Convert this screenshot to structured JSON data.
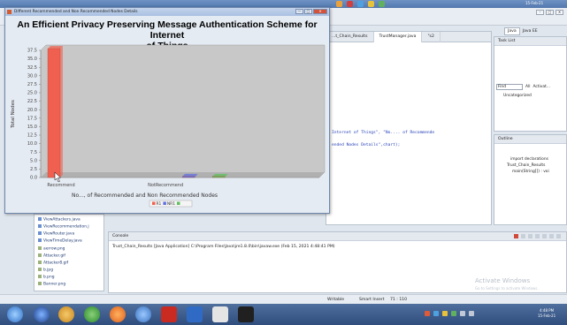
{
  "system_bar": {
    "date": "15-Feb-21"
  },
  "chart_window": {
    "title": "Different Recommended and Non Recommended Nodes Details",
    "controls": {
      "minimize": "—",
      "maximize": "□",
      "close": "✕"
    }
  },
  "chart_data": {
    "type": "bar",
    "title": "An Efficient Privacy Preserving Message Authentication Scheme for Internet of Things",
    "title_line1": "An Efficient Privacy Preserving Message Authentication Scheme for Internet",
    "title_line2": "of Things",
    "xlabel": "No..., of Recommended and Non Recommended Nodes",
    "ylabel": "Total Nodes",
    "categories": [
      "Recommend",
      "NotRecommend"
    ],
    "series": [
      {
        "name": "R1",
        "color": "#f06050",
        "values": [
          38,
          0
        ]
      },
      {
        "name": "NR1",
        "color": "#6070e0",
        "values": [
          0,
          0.3
        ]
      },
      {
        "name": "",
        "color": "#5ec05e",
        "values": [
          0,
          0.3
        ]
      }
    ],
    "ylim": [
      0,
      37.5
    ],
    "yticks": [
      "0.0",
      "2.5",
      "5.0",
      "7.5",
      "10.0",
      "12.5",
      "15.0",
      "17.5",
      "20.0",
      "22.5",
      "25.0",
      "27.5",
      "30.0",
      "32.5",
      "35.0",
      "37.5"
    ],
    "legend": "bottom-center",
    "grid": false
  },
  "editor": {
    "tabs": [
      "...t_Chain_Results",
      "TrustManager.java",
      "\"s2"
    ],
    "code_lines": [
      "Internet of Things\", \"No.... of Recommende",
      "ended Nodes Details\",chart);"
    ]
  },
  "right_panel": {
    "perspectives": [
      "Java",
      "Java EE"
    ],
    "task_list": {
      "title": "Task List",
      "find_placeholder": "Find",
      "filter_label": "All",
      "activate_label": "Activat...",
      "uncategorized": "Uncategorized"
    },
    "outline": {
      "title": "Outline",
      "items": [
        "import declarations",
        "Trust_Chain_Results",
        "main(String[]) : voi"
      ]
    }
  },
  "package_explorer": {
    "files": [
      "ViewAttackers.java",
      "ViewRecommendation.j",
      "ViewRouter.java",
      "ViewTimeDelay.java",
      "aerrow.png",
      "Attacker.gif",
      "Attacker8.gif",
      "b.jpg",
      "b.png",
      "Banner.png"
    ]
  },
  "console": {
    "tab_label": "Console",
    "line": "Trust_Chain_Results [Java Application] C:\\Program Files\\Java\\jre1.8.0\\bin\\javaw.exe (Feb 15, 2021 4:48:41 PM)"
  },
  "watermark": {
    "line1": "Activate Windows",
    "line2": "Go to Settings to activate Windows."
  },
  "status_bar": {
    "writable": "Writable",
    "insert_mode": "Smart Insert",
    "position": "71 : 110"
  },
  "taskbar": {
    "time": "4:48 PM",
    "date": "15-Feb-21"
  },
  "colors": {
    "window_border": "#6d87ad",
    "plot_bg": "#c8c8c8",
    "taskbar": "#2f4d7d"
  }
}
